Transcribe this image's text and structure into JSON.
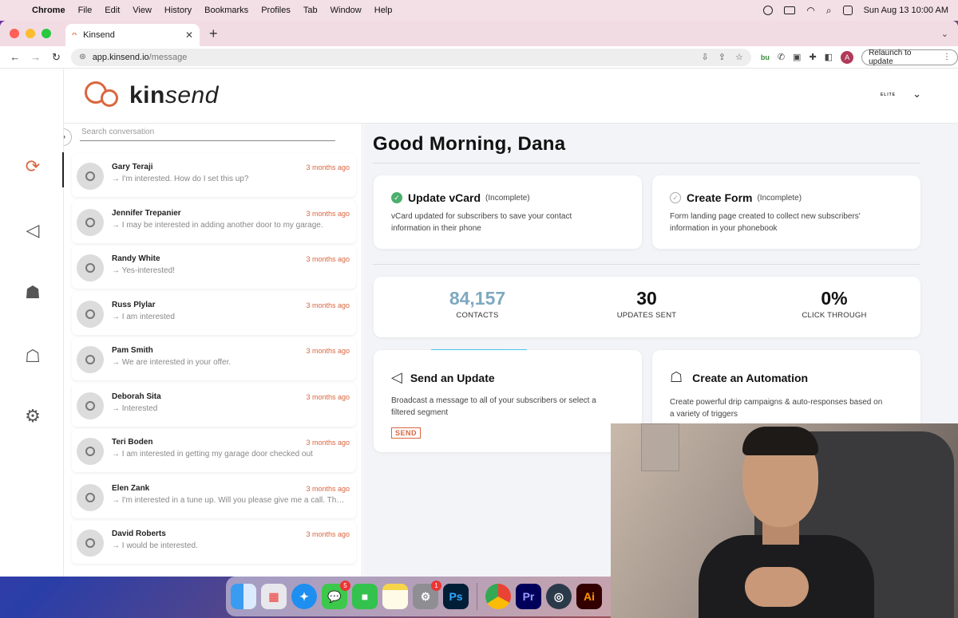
{
  "menubar": {
    "app": "Chrome",
    "items": [
      "File",
      "Edit",
      "View",
      "History",
      "Bookmarks",
      "Profiles",
      "Tab",
      "Window",
      "Help"
    ],
    "datetime": "Sun Aug 13  10:00 AM"
  },
  "browser": {
    "tab_title": "Kinsend",
    "url_host": "app.kinsend.io",
    "url_path": "/message",
    "relaunch_label": "Relaunch to update",
    "profile_initial": "A"
  },
  "app": {
    "logo_kin": "kin",
    "logo_send": "send",
    "header_brand": "ELITE",
    "search_placeholder": "Search conversation",
    "greeting": "Good Morning, Dana"
  },
  "conversations": [
    {
      "name": "Gary Teraji",
      "time": "3 months ago",
      "message": "→ I'm interested. How do I set this up?"
    },
    {
      "name": "Jennifer Trepanier",
      "time": "3 months ago",
      "message": "→ I may be interested in adding another door to my garage."
    },
    {
      "name": "Randy White",
      "time": "3 months ago",
      "message": "→ Yes-interested!"
    },
    {
      "name": "Russ Plylar",
      "time": "3 months ago",
      "message": "→ I am interested"
    },
    {
      "name": "Pam Smith",
      "time": "3 months ago",
      "message": "→ We are interested in your offer."
    },
    {
      "name": "Deborah Sita",
      "time": "3 months ago",
      "message": "→ Interested"
    },
    {
      "name": "Teri Boden",
      "time": "3 months ago",
      "message": "→ I am interested in getting my garage door checked out"
    },
    {
      "name": "Elen Zank",
      "time": "3 months ago",
      "message": "→ I'm interested in a tune up. Will you please give me a call. Thank you"
    },
    {
      "name": "David Roberts",
      "time": "3 months ago",
      "message": "→ I would be interested."
    }
  ],
  "tasks": {
    "vcard": {
      "title": "Update vCard",
      "status": "(Incomplete)",
      "desc1": "vCard updated for subscribers to save your contact",
      "desc2": "information in their phone"
    },
    "form": {
      "title": "Create Form",
      "status": "(Incomplete)",
      "desc1": "Form landing page created to collect new subscribers'",
      "desc2": "information in your phonebook"
    }
  },
  "stats": {
    "contacts": {
      "value": "84,157",
      "label": "CONTACTS"
    },
    "updates": {
      "value": "30",
      "label": "UPDATES SENT"
    },
    "click": {
      "value": "0%",
      "label": "CLICK THROUGH"
    }
  },
  "actions": {
    "send_update": {
      "title": "Send an Update",
      "desc1": "Broadcast a message to all of your subscribers or select a",
      "desc2": "filtered segment",
      "button": "SEND"
    },
    "automation": {
      "title": "Create an Automation",
      "desc1": "Create powerful drip campaigns & auto-responses based on",
      "desc2": "a variety of triggers"
    }
  },
  "dock": {
    "messages_badge": "5",
    "settings_badge": "1",
    "ps": "Ps",
    "pr": "Pr",
    "ai": "Ai"
  },
  "colors": {
    "accent": "#d9663f",
    "success": "#4caf6e",
    "video_overlay": "#3ec6f0"
  }
}
